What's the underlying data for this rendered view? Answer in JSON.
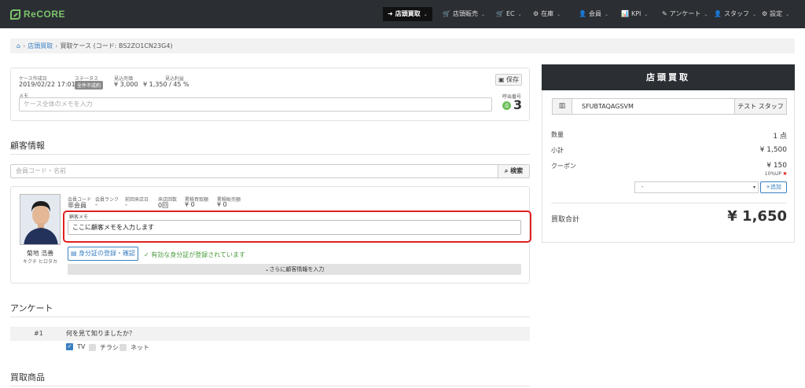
{
  "app": {
    "logo": "ReCORE"
  },
  "nav": [
    {
      "icon": "➜",
      "label": "店頭買取"
    },
    {
      "icon": "🛒",
      "label": "店頭販売"
    },
    {
      "icon": "🛒",
      "label": "EC"
    },
    {
      "icon": "⚙",
      "label": "在庫"
    },
    {
      "icon": "👤",
      "label": "会員"
    },
    {
      "icon": "📊",
      "label": "KPI"
    },
    {
      "icon": "✎",
      "label": "アンケート"
    },
    {
      "icon": "👤",
      "label": "スタッフ"
    },
    {
      "icon": "⚙",
      "label": "設定"
    }
  ],
  "breadcrumb": {
    "parent": "店頭買取",
    "current": "買取ケース (コード: BS2ZO1CN23G4)"
  },
  "case": {
    "created_label": "ケース作成日",
    "created_value": "2019/02/22 17:01",
    "status_label": "ステータス",
    "status_value": "全件不成約",
    "est_amount_label": "見込売価",
    "est_amount_value": "¥ 3,000",
    "est_profit_label": "見込利益",
    "est_profit_value": "¥ 1,350 / 45 %",
    "memo_label": "メモ",
    "memo_placeholder": "ケース全体のメモを入力",
    "save_label": "保存",
    "call_label": "呼出番号",
    "call_number": "3"
  },
  "customer": {
    "section_title": "顧客情報",
    "search_placeholder": "会員コード・名前",
    "search_button": "検索",
    "fields": [
      {
        "label": "会員コード",
        "value": "非会員"
      },
      {
        "label": "会員ランク",
        "value": "-"
      },
      {
        "label": "前回来店日",
        "value": "-"
      },
      {
        "label": "来店回数",
        "value": "0回"
      },
      {
        "label": "累積買取額",
        "value": "¥ 0"
      },
      {
        "label": "累積販売額",
        "value": "¥ 0"
      }
    ],
    "name": "菊地 浩善",
    "kana": "キクチ ヒロタカ",
    "memo_label": "顧客メモ",
    "memo_value": "ここに顧客メモを入力します",
    "id_button": "身分証の登録・確認",
    "id_status": "有効な身分証が登録されています",
    "more_button": "さらに顧客情報を入力"
  },
  "survey": {
    "section_title": "アンケート",
    "question_number": "#1",
    "question": "何を見て知りましたか？",
    "options": [
      {
        "label": "TV",
        "checked": true
      },
      {
        "label": "チラシ",
        "checked": false
      },
      {
        "label": "ネット",
        "checked": false
      }
    ]
  },
  "products": {
    "section_title": "買取商品"
  },
  "summary": {
    "title": "店頭買取",
    "code": "SFUBTAQAGSVM",
    "staff": "テスト スタッフ",
    "qty_label": "数量",
    "qty_value": "1 点",
    "subtotal_label": "小計",
    "subtotal_value": "¥ 1,500",
    "coupon_label": "クーポン",
    "coupon_value": "¥ 150",
    "coupon_detail": "10%UP",
    "coupon_select": "-",
    "add_button": "追加",
    "total_label": "買取合計",
    "total_value": "¥ 1,650"
  },
  "colors": {
    "nav_bg": "#2b2e33",
    "accent": "#3a7fc1",
    "brand": "#7cc36b",
    "highlight": "#e02020",
    "success": "#4a9c3c"
  }
}
